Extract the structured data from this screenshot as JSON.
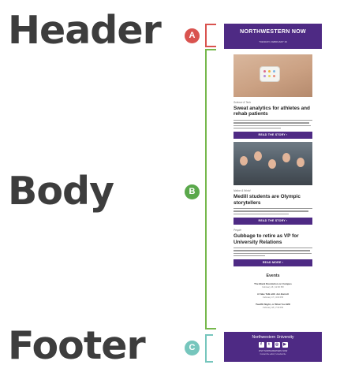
{
  "labels": {
    "header": "Header",
    "body": "Body",
    "footer": "Footer"
  },
  "markers": {
    "a": "A",
    "b": "B",
    "c": "C"
  },
  "newsletter": {
    "header": {
      "title": "NORTHWESTERN NOW",
      "date": "TUESDAY, FEBRUARY 16"
    },
    "stories": [
      {
        "category": "Science & Tech",
        "headline": "Sweat analytics for athletes and rehab patients",
        "button": "READ THE STORY  ›"
      },
      {
        "category": "Nation & World",
        "headline": "Medill students are Olympic storytellers",
        "button": "READ THE STORY  ›"
      },
      {
        "category": "People",
        "headline": "Gubbage to retire as VP for University Relations",
        "button": "READ MORE  ›"
      }
    ],
    "events": {
      "title": "Events",
      "items": [
        {
          "name": "The Black Revolution on Campus",
          "when": "February 16 | 12:00 PM"
        },
        {
          "name": "A Fake Talk with Jon Barrett",
          "when": "February 17 | 4:00 PM"
        },
        {
          "name": "Twelfth Night, or What You Will",
          "when": "February 18 | 7:30 PM"
        }
      ]
    },
    "footer": {
      "name": "Northwestern University",
      "link": "VISIT NORTHWESTERN NOW",
      "link2": "Contact the editor | Unsubscribe"
    }
  },
  "colors": {
    "brand": "#4e2a84",
    "marker_a": "#d9534f",
    "marker_b": "#5aa84b",
    "marker_c": "#76c6bd"
  }
}
